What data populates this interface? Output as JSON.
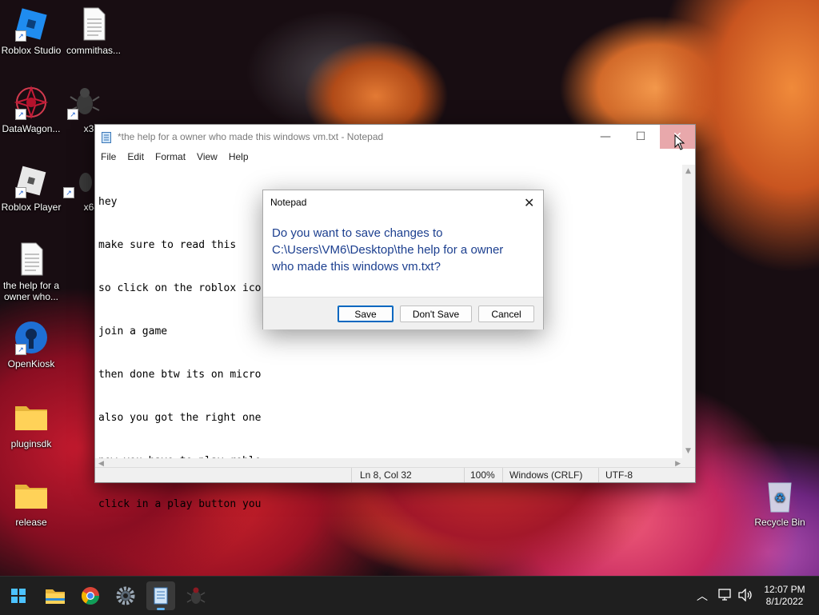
{
  "desktop": {
    "icons": [
      {
        "label": "Roblox Studio"
      },
      {
        "label": "commithas..."
      },
      {
        "label": "DataWagon..."
      },
      {
        "label": "x32"
      },
      {
        "label": "Roblox Player"
      },
      {
        "label": "x64"
      },
      {
        "label": "the help for a owner who..."
      },
      {
        "label": "OpenKiosk"
      },
      {
        "label": "pluginsdk"
      },
      {
        "label": "release"
      },
      {
        "label": "Recycle Bin"
      }
    ]
  },
  "notepad": {
    "title": "*the help for a owner who  made this windows vm.txt - Notepad",
    "menu": [
      "File",
      "Edit",
      "Format",
      "View",
      "Help"
    ],
    "lines": [
      "hey",
      "make sure to read this",
      "so click on the roblox ico",
      "join a game",
      "then done btw its on micro",
      "also you got the right one",
      "now you have to play roblo",
      "click in a play button you"
    ],
    "status": {
      "position": "Ln 8, Col 32",
      "zoom": "100%",
      "line_ending": "Windows (CRLF)",
      "encoding": "UTF-8"
    }
  },
  "dialog": {
    "title": "Notepad",
    "message": "Do you want to save changes to C:\\Users\\VM6\\Desktop\\the help for a owner who  made this windows vm.txt?",
    "buttons": {
      "save": "Save",
      "dont_save": "Don't Save",
      "cancel": "Cancel"
    }
  },
  "taskbar": {
    "apps": [
      "start-icon",
      "file-explorer-icon",
      "chrome-icon",
      "settings-icon",
      "notepad-icon",
      "bug-app-icon"
    ],
    "clock": {
      "time": "12:07 PM",
      "date": "8/1/2022"
    }
  },
  "colors": {
    "dialog_text": "#1c3f8f",
    "primary_button_border": "#0067c0",
    "close_hover": "#e8a8ab"
  }
}
